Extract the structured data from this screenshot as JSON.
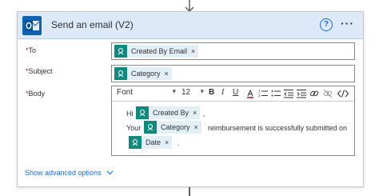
{
  "card": {
    "title": "Send an email (V2)",
    "help": "?",
    "more": "···",
    "accent_color": "#0f62b1",
    "token_icon_color": "#0f8a7e"
  },
  "fields": {
    "to": {
      "required": "*",
      "label": "To",
      "token": "Created By Email",
      "remove": "×"
    },
    "subject": {
      "required": "*",
      "label": "Subject",
      "token": "Category",
      "remove": "×"
    },
    "body": {
      "required": "*",
      "label": "Body"
    }
  },
  "toolbar": {
    "font": "Font",
    "size": "12",
    "bold": "B",
    "italic": "I",
    "underline": "U",
    "chevron": "▾"
  },
  "body_content": {
    "line1_prefix": "Hi",
    "token1": "Created By",
    "line1_suffix": ",",
    "line2_prefix": "Your",
    "token2": "Category",
    "line2_suffix": "reimbursement is successfully submitted on",
    "token3": "Date",
    "line3_suffix": ".",
    "remove": "×"
  },
  "footer": {
    "show_advanced": "Show advanced options",
    "chevron": "⌄"
  }
}
